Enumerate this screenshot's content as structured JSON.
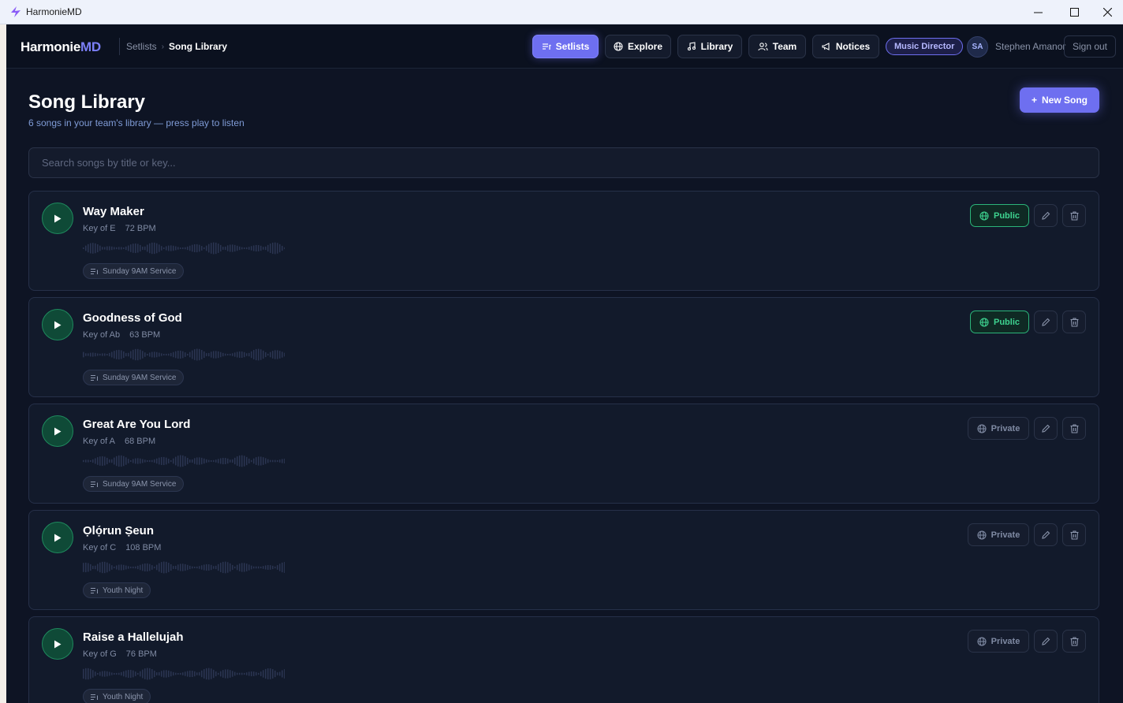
{
  "window": {
    "title": "HarmonieMD"
  },
  "brand": {
    "name": "Harmonie",
    "suffix": "MD"
  },
  "breadcrumb": {
    "parent": "Setlists",
    "current": "Song Library"
  },
  "nav": {
    "setlists": "Setlists",
    "explore": "Explore",
    "library": "Library",
    "team": "Team",
    "notices": "Notices",
    "active": "setlists"
  },
  "user": {
    "role": "Music Director",
    "initials": "SA",
    "name": "Stephen Amanor",
    "signout": "Sign out"
  },
  "page": {
    "title": "Song Library",
    "subtitle": "6 songs in your team's library — press play to listen",
    "new_song": "New Song",
    "new_song_icon": "+"
  },
  "search": {
    "placeholder": "Search songs by title or key...",
    "value": ""
  },
  "songs": [
    {
      "title": "Way Maker",
      "key": "Key of E",
      "bpm": "72 BPM",
      "setlist": "Sunday 9AM Service",
      "visibility": "Public"
    },
    {
      "title": "Goodness of God",
      "key": "Key of Ab",
      "bpm": "63 BPM",
      "setlist": "Sunday 9AM Service",
      "visibility": "Public"
    },
    {
      "title": "Great Are You Lord",
      "key": "Key of A",
      "bpm": "68 BPM",
      "setlist": "Sunday 9AM Service",
      "visibility": "Private"
    },
    {
      "title": "Ọlọ́run Ṣeun",
      "key": "Key of C",
      "bpm": "108 BPM",
      "setlist": "Youth Night",
      "visibility": "Private"
    },
    {
      "title": "Raise a Hallelujah",
      "key": "Key of G",
      "bpm": "76 BPM",
      "setlist": "Youth Night",
      "visibility": "Private"
    }
  ],
  "colors": {
    "accent": "#6e6ff0",
    "background": "#0e1424",
    "card": "#121a2b",
    "public_green": "#3ed390",
    "play_green": "#0f4a37"
  },
  "icons": {
    "play": "play-icon",
    "public": "globe-icon",
    "edit": "pencil-icon",
    "delete": "trash-icon",
    "setlist": "playlist-icon"
  }
}
